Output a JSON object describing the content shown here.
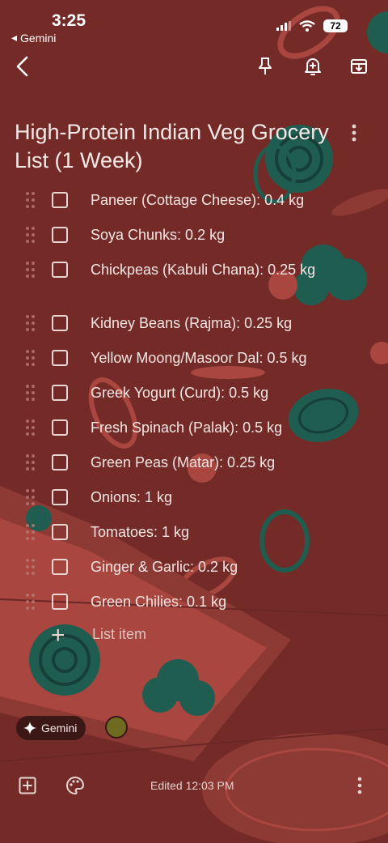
{
  "status_bar": {
    "time": "3:25",
    "back_app": "Gemini",
    "battery": "72"
  },
  "toolbar": {
    "back_icon": "back-arrow-icon",
    "pin_icon": "pin-icon",
    "reminder_icon": "reminder-bell-icon",
    "archive_icon": "archive-icon"
  },
  "note": {
    "title": "High-Protein Indian Veg Grocery List (1 Week)",
    "items": [
      {
        "label": "Paneer (Cottage Cheese): 0.4 kg",
        "checked": false
      },
      {
        "label": "Soya Chunks: 0.2 kg",
        "checked": false
      },
      {
        "label": "Chickpeas (Kabuli Chana): 0.25 kg",
        "checked": false
      },
      {
        "label": "Kidney Beans (Rajma): 0.25 kg",
        "checked": false
      },
      {
        "label": "Yellow Moong/Masoor Dal: 0.5 kg",
        "checked": false
      },
      {
        "label": "Greek Yogurt (Curd): 0.5 kg",
        "checked": false
      },
      {
        "label": "Fresh Spinach (Palak): 0.5 kg",
        "checked": false
      },
      {
        "label": "Green Peas (Matar): 0.25 kg",
        "checked": false
      },
      {
        "label": "Onions: 1 kg",
        "checked": false
      },
      {
        "label": "Tomatoes: 1 kg",
        "checked": false
      },
      {
        "label": "Ginger & Garlic: 0.2 kg",
        "checked": false
      },
      {
        "label": "Green Chilies: 0.1 kg",
        "checked": false
      }
    ],
    "add_item_placeholder": "List item"
  },
  "chips": {
    "gemini_label": "Gemini"
  },
  "bottom_bar": {
    "edited_text": "Edited 12:03 PM"
  },
  "colors": {
    "background": "#742b28",
    "chip_background": "#3b1715",
    "color_dot": "#6e6a1f",
    "accent_green": "#1f5d50"
  }
}
